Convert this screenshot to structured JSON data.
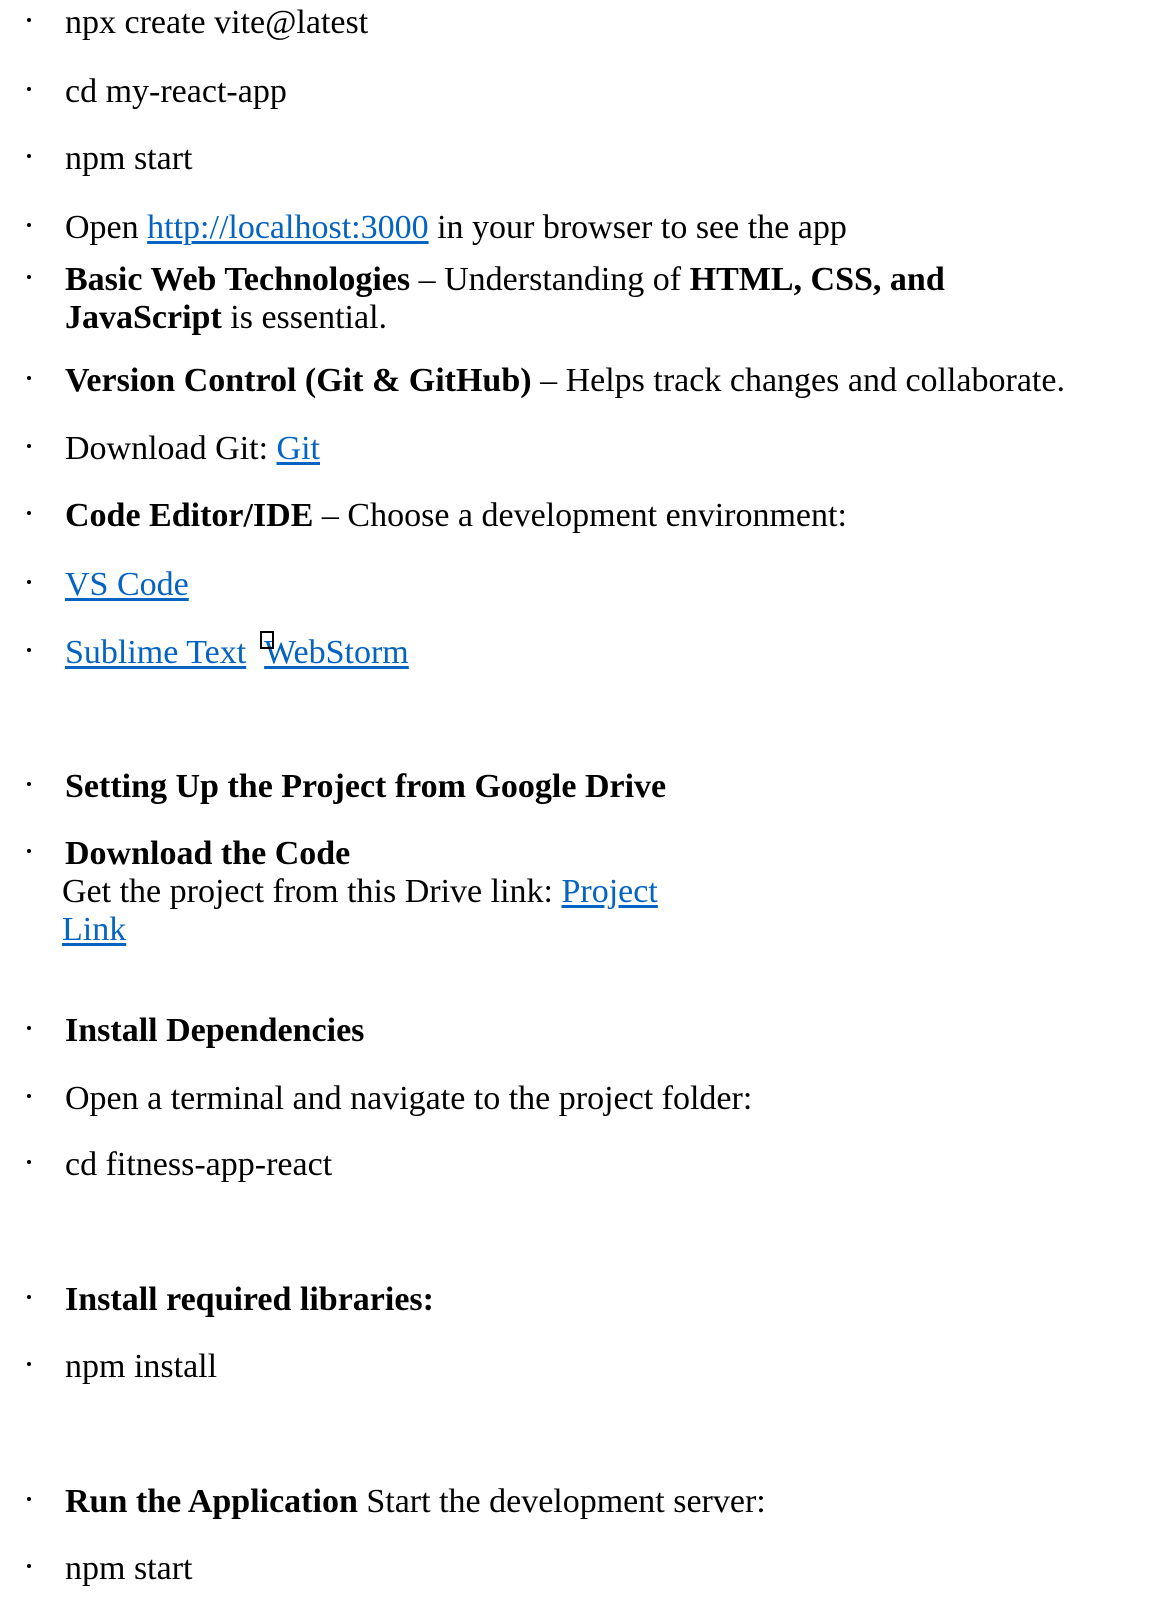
{
  "items": [
    {
      "text": "npx create vite@latest"
    },
    {
      "text": "cd my-react-app"
    },
    {
      "text": "npm start"
    },
    {
      "open": "Open ",
      "link": "http://localhost:3000",
      "rest": " in your browser to see the app"
    },
    {
      "bold1": "Basic Web Technologies",
      "mid": " – Understanding of ",
      "bold2": "HTML, CSS, and",
      "bold3": "JavaScript",
      "rest": " is essential."
    },
    {
      "bold": "Version Control (Git & GitHub)",
      "rest": " – Helps track changes and collaborate."
    },
    {
      "text": "Download Git: ",
      "link": "Git"
    },
    {
      "bold": "Code Editor/IDE",
      "rest": " – Choose a development environment:"
    },
    {
      "link": "VS Code"
    },
    {
      "link1": "Sublime Text",
      "link2": "WebStorm"
    },
    {
      "bold": "Setting Up the Project from Google Drive"
    },
    {
      "bold": "Download the Code",
      "line": "Get the project from this Drive link: ",
      "link1": "Project",
      "link2": "Link"
    },
    {
      "bold": "Install Dependencies"
    },
    {
      "text": "Open a terminal and navigate to the project folder:"
    },
    {
      "text": "cd fitness-app-react"
    },
    {
      "bold": "Install required libraries:"
    },
    {
      "text": "npm install"
    },
    {
      "bold": "Run the Application",
      "rest": " Start the development server:"
    },
    {
      "text": "npm start"
    }
  ],
  "colors": {
    "link": "#0563c1",
    "text": "#000000",
    "background": "#ffffff"
  }
}
